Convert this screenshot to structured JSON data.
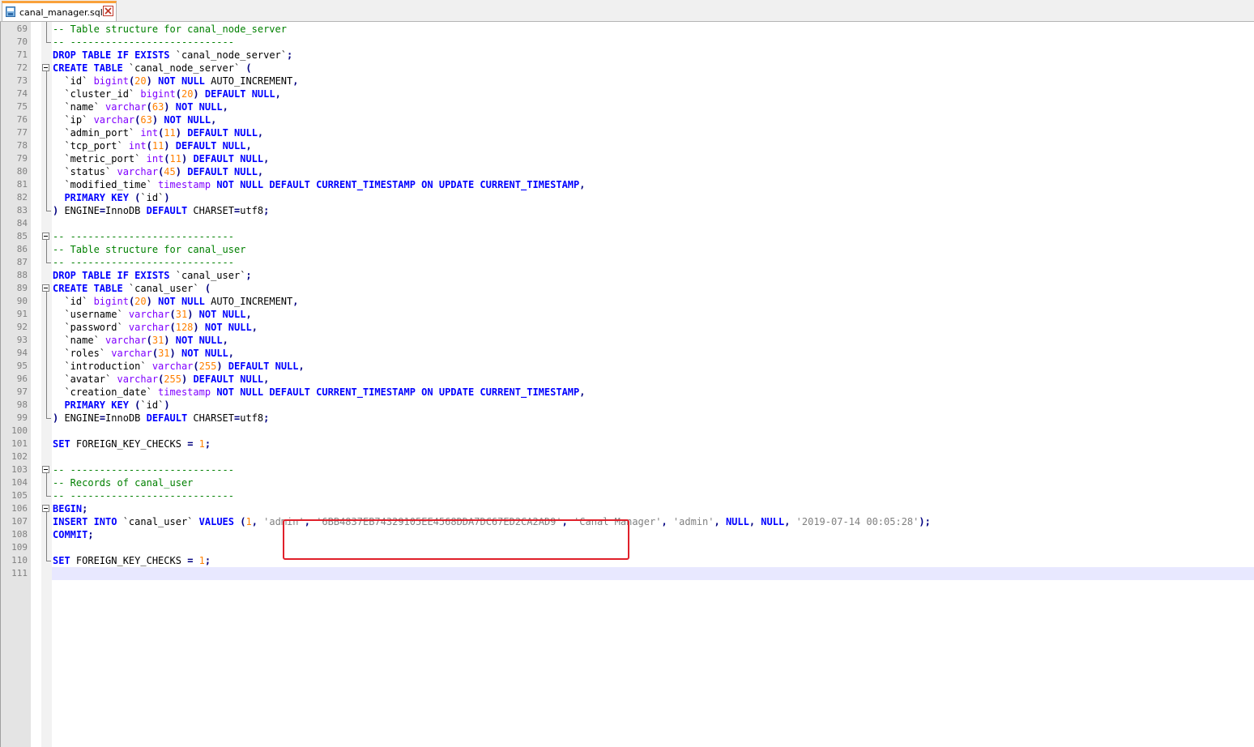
{
  "tab": {
    "filename": "canal_manager.sql",
    "icon": "sql-file-icon",
    "close_icon": "close-icon",
    "accent_color": "#f9a13b"
  },
  "colors": {
    "keyword": "#0000ff",
    "type": "#8000ff",
    "number": "#ff8000",
    "string": "#808080",
    "comment": "#008000",
    "annotation_box": "#e0202a"
  },
  "lines": [
    {
      "n": "69",
      "tokens": [
        {
          "t": "-- Table structure for canal_node_server",
          "c": "cm"
        }
      ]
    },
    {
      "n": "70",
      "tokens": [
        {
          "t": "-- ----------------------------",
          "c": "cm"
        }
      ]
    },
    {
      "n": "71",
      "tokens": [
        {
          "t": "DROP TABLE IF EXISTS",
          "c": "kw"
        },
        {
          "t": " `canal_node_server`",
          "c": ""
        },
        {
          "t": ";",
          "c": "op"
        }
      ]
    },
    {
      "n": "72",
      "tokens": [
        {
          "t": "CREATE TABLE",
          "c": "kw"
        },
        {
          "t": " `canal_node_server` ",
          "c": ""
        },
        {
          "t": "(",
          "c": "op"
        }
      ]
    },
    {
      "n": "73",
      "tokens": [
        {
          "t": "  `id` ",
          "c": ""
        },
        {
          "t": "bigint",
          "c": "ty"
        },
        {
          "t": "(",
          "c": "op"
        },
        {
          "t": "20",
          "c": "num"
        },
        {
          "t": ")",
          "c": "op"
        },
        {
          "t": " ",
          "c": ""
        },
        {
          "t": "NOT NULL",
          "c": "kw"
        },
        {
          "t": " AUTO_INCREMENT",
          "c": ""
        },
        {
          "t": ",",
          "c": "op"
        }
      ]
    },
    {
      "n": "74",
      "tokens": [
        {
          "t": "  `cluster_id` ",
          "c": ""
        },
        {
          "t": "bigint",
          "c": "ty"
        },
        {
          "t": "(",
          "c": "op"
        },
        {
          "t": "20",
          "c": "num"
        },
        {
          "t": ")",
          "c": "op"
        },
        {
          "t": " ",
          "c": ""
        },
        {
          "t": "DEFAULT NULL",
          "c": "kw"
        },
        {
          "t": ",",
          "c": "op"
        }
      ]
    },
    {
      "n": "75",
      "tokens": [
        {
          "t": "  `name` ",
          "c": ""
        },
        {
          "t": "varchar",
          "c": "ty"
        },
        {
          "t": "(",
          "c": "op"
        },
        {
          "t": "63",
          "c": "num"
        },
        {
          "t": ")",
          "c": "op"
        },
        {
          "t": " ",
          "c": ""
        },
        {
          "t": "NOT NULL",
          "c": "kw"
        },
        {
          "t": ",",
          "c": "op"
        }
      ]
    },
    {
      "n": "76",
      "tokens": [
        {
          "t": "  `ip` ",
          "c": ""
        },
        {
          "t": "varchar",
          "c": "ty"
        },
        {
          "t": "(",
          "c": "op"
        },
        {
          "t": "63",
          "c": "num"
        },
        {
          "t": ")",
          "c": "op"
        },
        {
          "t": " ",
          "c": ""
        },
        {
          "t": "NOT NULL",
          "c": "kw"
        },
        {
          "t": ",",
          "c": "op"
        }
      ]
    },
    {
      "n": "77",
      "tokens": [
        {
          "t": "  `admin_port` ",
          "c": ""
        },
        {
          "t": "int",
          "c": "ty"
        },
        {
          "t": "(",
          "c": "op"
        },
        {
          "t": "11",
          "c": "num"
        },
        {
          "t": ")",
          "c": "op"
        },
        {
          "t": " ",
          "c": ""
        },
        {
          "t": "DEFAULT NULL",
          "c": "kw"
        },
        {
          "t": ",",
          "c": "op"
        }
      ]
    },
    {
      "n": "78",
      "tokens": [
        {
          "t": "  `tcp_port` ",
          "c": ""
        },
        {
          "t": "int",
          "c": "ty"
        },
        {
          "t": "(",
          "c": "op"
        },
        {
          "t": "11",
          "c": "num"
        },
        {
          "t": ")",
          "c": "op"
        },
        {
          "t": " ",
          "c": ""
        },
        {
          "t": "DEFAULT NULL",
          "c": "kw"
        },
        {
          "t": ",",
          "c": "op"
        }
      ]
    },
    {
      "n": "79",
      "tokens": [
        {
          "t": "  `metric_port` ",
          "c": ""
        },
        {
          "t": "int",
          "c": "ty"
        },
        {
          "t": "(",
          "c": "op"
        },
        {
          "t": "11",
          "c": "num"
        },
        {
          "t": ")",
          "c": "op"
        },
        {
          "t": " ",
          "c": ""
        },
        {
          "t": "DEFAULT NULL",
          "c": "kw"
        },
        {
          "t": ",",
          "c": "op"
        }
      ]
    },
    {
      "n": "80",
      "tokens": [
        {
          "t": "  `status` ",
          "c": ""
        },
        {
          "t": "varchar",
          "c": "ty"
        },
        {
          "t": "(",
          "c": "op"
        },
        {
          "t": "45",
          "c": "num"
        },
        {
          "t": ")",
          "c": "op"
        },
        {
          "t": " ",
          "c": ""
        },
        {
          "t": "DEFAULT NULL",
          "c": "kw"
        },
        {
          "t": ",",
          "c": "op"
        }
      ]
    },
    {
      "n": "81",
      "tokens": [
        {
          "t": "  `modified_time` ",
          "c": ""
        },
        {
          "t": "timestamp",
          "c": "ty"
        },
        {
          "t": " ",
          "c": ""
        },
        {
          "t": "NOT NULL DEFAULT CURRENT_TIMESTAMP ON UPDATE CURRENT_TIMESTAMP",
          "c": "kw"
        },
        {
          "t": ",",
          "c": "op"
        }
      ]
    },
    {
      "n": "82",
      "tokens": [
        {
          "t": "  ",
          "c": ""
        },
        {
          "t": "PRIMARY KEY",
          "c": "kw"
        },
        {
          "t": " ",
          "c": ""
        },
        {
          "t": "(",
          "c": "op"
        },
        {
          "t": "`id`",
          "c": ""
        },
        {
          "t": ")",
          "c": "op"
        }
      ]
    },
    {
      "n": "83",
      "tokens": [
        {
          "t": ")",
          "c": "op"
        },
        {
          "t": " ENGINE",
          "c": ""
        },
        {
          "t": "=",
          "c": "op"
        },
        {
          "t": "InnoDB ",
          "c": ""
        },
        {
          "t": "DEFAULT",
          "c": "kw"
        },
        {
          "t": " CHARSET",
          "c": ""
        },
        {
          "t": "=",
          "c": "op"
        },
        {
          "t": "utf8",
          "c": ""
        },
        {
          "t": ";",
          "c": "op"
        }
      ]
    },
    {
      "n": "84",
      "tokens": []
    },
    {
      "n": "85",
      "tokens": [
        {
          "t": "-- ----------------------------",
          "c": "cm"
        }
      ]
    },
    {
      "n": "86",
      "tokens": [
        {
          "t": "-- Table structure for canal_user",
          "c": "cm"
        }
      ]
    },
    {
      "n": "87",
      "tokens": [
        {
          "t": "-- ----------------------------",
          "c": "cm"
        }
      ]
    },
    {
      "n": "88",
      "tokens": [
        {
          "t": "DROP TABLE IF EXISTS",
          "c": "kw"
        },
        {
          "t": " `canal_user`",
          "c": ""
        },
        {
          "t": ";",
          "c": "op"
        }
      ]
    },
    {
      "n": "89",
      "tokens": [
        {
          "t": "CREATE TABLE",
          "c": "kw"
        },
        {
          "t": " `canal_user` ",
          "c": ""
        },
        {
          "t": "(",
          "c": "op"
        }
      ]
    },
    {
      "n": "90",
      "tokens": [
        {
          "t": "  `id` ",
          "c": ""
        },
        {
          "t": "bigint",
          "c": "ty"
        },
        {
          "t": "(",
          "c": "op"
        },
        {
          "t": "20",
          "c": "num"
        },
        {
          "t": ")",
          "c": "op"
        },
        {
          "t": " ",
          "c": ""
        },
        {
          "t": "NOT NULL",
          "c": "kw"
        },
        {
          "t": " AUTO_INCREMENT",
          "c": ""
        },
        {
          "t": ",",
          "c": "op"
        }
      ]
    },
    {
      "n": "91",
      "tokens": [
        {
          "t": "  `username` ",
          "c": ""
        },
        {
          "t": "varchar",
          "c": "ty"
        },
        {
          "t": "(",
          "c": "op"
        },
        {
          "t": "31",
          "c": "num"
        },
        {
          "t": ")",
          "c": "op"
        },
        {
          "t": " ",
          "c": ""
        },
        {
          "t": "NOT NULL",
          "c": "kw"
        },
        {
          "t": ",",
          "c": "op"
        }
      ]
    },
    {
      "n": "92",
      "tokens": [
        {
          "t": "  `password` ",
          "c": ""
        },
        {
          "t": "varchar",
          "c": "ty"
        },
        {
          "t": "(",
          "c": "op"
        },
        {
          "t": "128",
          "c": "num"
        },
        {
          "t": ")",
          "c": "op"
        },
        {
          "t": " ",
          "c": ""
        },
        {
          "t": "NOT NULL",
          "c": "kw"
        },
        {
          "t": ",",
          "c": "op"
        }
      ]
    },
    {
      "n": "93",
      "tokens": [
        {
          "t": "  `name` ",
          "c": ""
        },
        {
          "t": "varchar",
          "c": "ty"
        },
        {
          "t": "(",
          "c": "op"
        },
        {
          "t": "31",
          "c": "num"
        },
        {
          "t": ")",
          "c": "op"
        },
        {
          "t": " ",
          "c": ""
        },
        {
          "t": "NOT NULL",
          "c": "kw"
        },
        {
          "t": ",",
          "c": "op"
        }
      ]
    },
    {
      "n": "94",
      "tokens": [
        {
          "t": "  `roles` ",
          "c": ""
        },
        {
          "t": "varchar",
          "c": "ty"
        },
        {
          "t": "(",
          "c": "op"
        },
        {
          "t": "31",
          "c": "num"
        },
        {
          "t": ")",
          "c": "op"
        },
        {
          "t": " ",
          "c": ""
        },
        {
          "t": "NOT NULL",
          "c": "kw"
        },
        {
          "t": ",",
          "c": "op"
        }
      ]
    },
    {
      "n": "95",
      "tokens": [
        {
          "t": "  `introduction` ",
          "c": ""
        },
        {
          "t": "varchar",
          "c": "ty"
        },
        {
          "t": "(",
          "c": "op"
        },
        {
          "t": "255",
          "c": "num"
        },
        {
          "t": ")",
          "c": "op"
        },
        {
          "t": " ",
          "c": ""
        },
        {
          "t": "DEFAULT NULL",
          "c": "kw"
        },
        {
          "t": ",",
          "c": "op"
        }
      ]
    },
    {
      "n": "96",
      "tokens": [
        {
          "t": "  `avatar` ",
          "c": ""
        },
        {
          "t": "varchar",
          "c": "ty"
        },
        {
          "t": "(",
          "c": "op"
        },
        {
          "t": "255",
          "c": "num"
        },
        {
          "t": ")",
          "c": "op"
        },
        {
          "t": " ",
          "c": ""
        },
        {
          "t": "DEFAULT NULL",
          "c": "kw"
        },
        {
          "t": ",",
          "c": "op"
        }
      ]
    },
    {
      "n": "97",
      "tokens": [
        {
          "t": "  `creation_date` ",
          "c": ""
        },
        {
          "t": "timestamp",
          "c": "ty"
        },
        {
          "t": " ",
          "c": ""
        },
        {
          "t": "NOT NULL DEFAULT CURRENT_TIMESTAMP ON UPDATE CURRENT_TIMESTAMP",
          "c": "kw"
        },
        {
          "t": ",",
          "c": "op"
        }
      ]
    },
    {
      "n": "98",
      "tokens": [
        {
          "t": "  ",
          "c": ""
        },
        {
          "t": "PRIMARY KEY",
          "c": "kw"
        },
        {
          "t": " ",
          "c": ""
        },
        {
          "t": "(",
          "c": "op"
        },
        {
          "t": "`id`",
          "c": ""
        },
        {
          "t": ")",
          "c": "op"
        }
      ]
    },
    {
      "n": "99",
      "tokens": [
        {
          "t": ")",
          "c": "op"
        },
        {
          "t": " ENGINE",
          "c": ""
        },
        {
          "t": "=",
          "c": "op"
        },
        {
          "t": "InnoDB ",
          "c": ""
        },
        {
          "t": "DEFAULT",
          "c": "kw"
        },
        {
          "t": " CHARSET",
          "c": ""
        },
        {
          "t": "=",
          "c": "op"
        },
        {
          "t": "utf8",
          "c": ""
        },
        {
          "t": ";",
          "c": "op"
        }
      ]
    },
    {
      "n": "100",
      "tokens": []
    },
    {
      "n": "101",
      "tokens": [
        {
          "t": "SET",
          "c": "kw"
        },
        {
          "t": " FOREIGN_KEY_CHECKS ",
          "c": ""
        },
        {
          "t": "=",
          "c": "op"
        },
        {
          "t": " ",
          "c": ""
        },
        {
          "t": "1",
          "c": "num"
        },
        {
          "t": ";",
          "c": "op"
        }
      ]
    },
    {
      "n": "102",
      "tokens": []
    },
    {
      "n": "103",
      "tokens": [
        {
          "t": "-- ----------------------------",
          "c": "cm"
        }
      ]
    },
    {
      "n": "104",
      "tokens": [
        {
          "t": "-- Records of canal_user",
          "c": "cm"
        }
      ]
    },
    {
      "n": "105",
      "tokens": [
        {
          "t": "-- ----------------------------",
          "c": "cm"
        }
      ]
    },
    {
      "n": "106",
      "tokens": [
        {
          "t": "BEGIN",
          "c": "kw"
        },
        {
          "t": ";",
          "c": "op"
        }
      ]
    },
    {
      "n": "107",
      "tokens": [
        {
          "t": "INSERT INTO",
          "c": "kw"
        },
        {
          "t": " `canal_user` ",
          "c": ""
        },
        {
          "t": "VALUES",
          "c": "kw"
        },
        {
          "t": " ",
          "c": ""
        },
        {
          "t": "(",
          "c": "op"
        },
        {
          "t": "1",
          "c": "num"
        },
        {
          "t": ", ",
          "c": "op"
        },
        {
          "t": "'admin'",
          "c": "str"
        },
        {
          "t": ", ",
          "c": "op"
        },
        {
          "t": "'6BB4837EB74329105EE4568DDA7DC67ED2CA2AD9'",
          "c": "str"
        },
        {
          "t": ", ",
          "c": "op"
        },
        {
          "t": "'Canal Manager'",
          "c": "str"
        },
        {
          "t": ", ",
          "c": "op"
        },
        {
          "t": "'admin'",
          "c": "str"
        },
        {
          "t": ", ",
          "c": "op"
        },
        {
          "t": "NULL",
          "c": "kw"
        },
        {
          "t": ", ",
          "c": "op"
        },
        {
          "t": "NULL",
          "c": "kw"
        },
        {
          "t": ", ",
          "c": "op"
        },
        {
          "t": "'2019-07-14 00:05:28'",
          "c": "str"
        },
        {
          "t": ");",
          "c": "op"
        }
      ]
    },
    {
      "n": "108",
      "tokens": [
        {
          "t": "COMMIT",
          "c": "kw"
        },
        {
          "t": ";",
          "c": "op"
        }
      ]
    },
    {
      "n": "109",
      "tokens": []
    },
    {
      "n": "110",
      "tokens": [
        {
          "t": "SET",
          "c": "kw"
        },
        {
          "t": " FOREIGN_KEY_CHECKS ",
          "c": ""
        },
        {
          "t": "=",
          "c": "op"
        },
        {
          "t": " ",
          "c": ""
        },
        {
          "t": "1",
          "c": "num"
        },
        {
          "t": ";",
          "c": "op"
        }
      ]
    },
    {
      "n": "111",
      "tokens": []
    }
  ],
  "current_line": "111",
  "annotated_line": "107"
}
